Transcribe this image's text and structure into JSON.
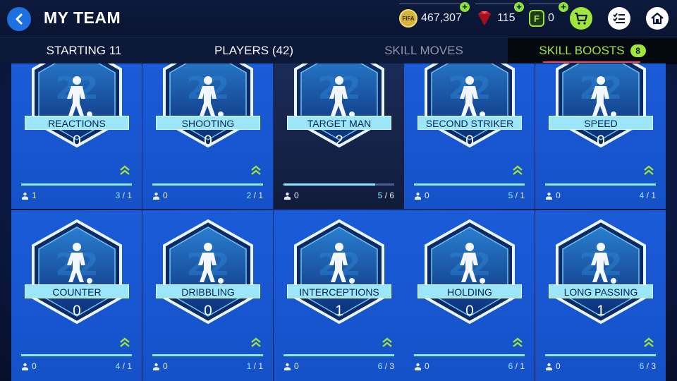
{
  "header": {
    "title": "MY TEAM",
    "coins": "467,307",
    "coins_icon_text": "FIFA",
    "gems": "115",
    "fifa_points": "0",
    "fifa_points_icon_text": "F"
  },
  "tabs": [
    {
      "label": "STARTING 11"
    },
    {
      "label": "PLAYERS (42)"
    },
    {
      "label": "SKILL MOVES"
    },
    {
      "label": "SKILL BOOSTS",
      "badge": "8"
    }
  ],
  "skills": [
    {
      "name": "REACTIONS",
      "level": "0",
      "count": "1",
      "progress_current": "3",
      "progress_total": "1",
      "progress": 1.0,
      "upgradable": true
    },
    {
      "name": "SHOOTING",
      "level": "0",
      "count": "0",
      "progress_current": "2",
      "progress_total": "1",
      "progress": 1.0,
      "upgradable": true
    },
    {
      "name": "TARGET MAN",
      "level": "2",
      "count": "0",
      "progress_current": "5",
      "progress_total": "6",
      "progress": 0.83,
      "upgradable": false
    },
    {
      "name": "SECOND STRIKER",
      "level": "0",
      "count": "0",
      "progress_current": "5",
      "progress_total": "1",
      "progress": 1.0,
      "upgradable": true
    },
    {
      "name": "SPEED",
      "level": "0",
      "count": "0",
      "progress_current": "4",
      "progress_total": "1",
      "progress": 1.0,
      "upgradable": true
    },
    {
      "name": "COUNTER",
      "level": "0",
      "count": "0",
      "progress_current": "4",
      "progress_total": "1",
      "progress": 1.0,
      "upgradable": true
    },
    {
      "name": "DRIBBLING",
      "level": "0",
      "count": "0",
      "progress_current": "1",
      "progress_total": "1",
      "progress": 1.0,
      "upgradable": true
    },
    {
      "name": "INTERCEPTIONS",
      "level": "1",
      "count": "0",
      "progress_current": "6",
      "progress_total": "3",
      "progress": 1.0,
      "upgradable": true
    },
    {
      "name": "HOLDING",
      "level": "0",
      "count": "0",
      "progress_current": "6",
      "progress_total": "1",
      "progress": 1.0,
      "upgradable": true
    },
    {
      "name": "LONG PASSING",
      "level": "1",
      "count": "0",
      "progress_current": "6",
      "progress_total": "3",
      "progress": 1.0,
      "upgradable": true
    }
  ],
  "colors": {
    "accent_green": "#9ee63a",
    "tab_underline": "#ff3a7a",
    "card_blue": "#1a5bd8",
    "ribbon": "#9be6f8"
  }
}
